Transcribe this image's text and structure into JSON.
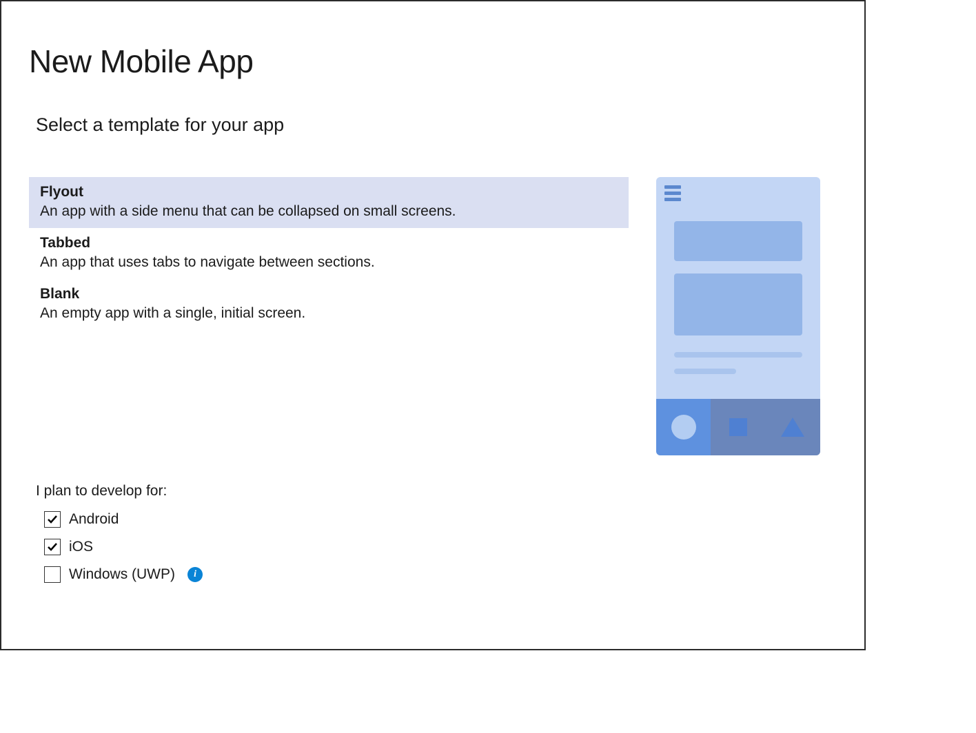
{
  "title": "New Mobile App",
  "subtitle": "Select a template for your app",
  "templates": [
    {
      "name": "Flyout",
      "description": "An app with a side menu that can be collapsed on small screens.",
      "selected": true
    },
    {
      "name": "Tabbed",
      "description": "An app that uses tabs to navigate between sections.",
      "selected": false
    },
    {
      "name": "Blank",
      "description": "An empty app with a single, initial screen.",
      "selected": false
    }
  ],
  "platforms_label": "I plan to develop for:",
  "platforms": [
    {
      "label": "Android",
      "checked": true,
      "info": false
    },
    {
      "label": "iOS",
      "checked": true,
      "info": false
    },
    {
      "label": "Windows (UWP)",
      "checked": false,
      "info": true
    }
  ],
  "colors": {
    "selection_bg": "#dadff2",
    "preview_bg": "#c3d6f5",
    "preview_accent": "#93b5e8",
    "preview_nav_active": "#5e91df",
    "preview_nav_inactive": "#6a86bb",
    "info_icon": "#0a84d6"
  }
}
